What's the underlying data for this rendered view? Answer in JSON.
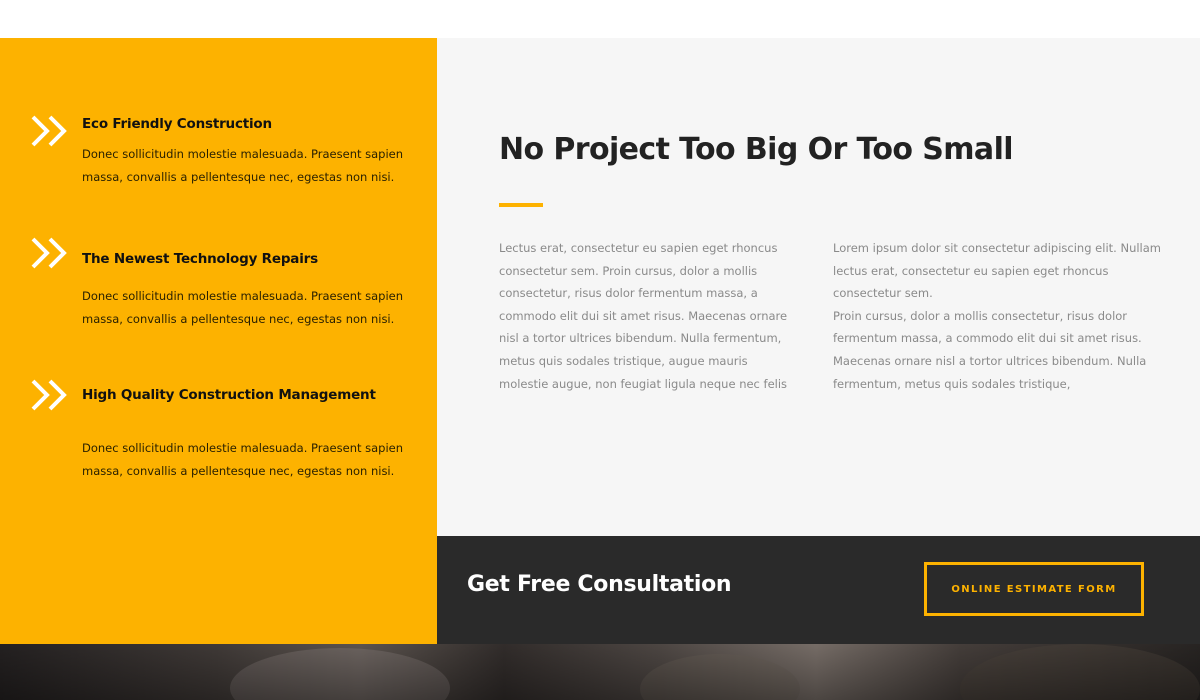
{
  "features": [
    {
      "icon": "double-chevron-right-icon",
      "title": "Eco Friendly Construction",
      "description": "Donec sollicitudin molestie malesuada. Praesent sapien massa, convallis a pellentesque nec, egestas non nisi."
    },
    {
      "icon": "double-chevron-right-icon",
      "title": "The Newest Technology Repairs",
      "description": "Donec sollicitudin molestie malesuada. Praesent sapien massa, convallis a pellentesque nec, egestas non nisi."
    },
    {
      "icon": "double-chevron-right-icon",
      "title": "High Quality Construction Management",
      "description": "Donec sollicitudin molestie malesuada. Praesent sapien massa, convallis a pellentesque nec, egestas non nisi."
    }
  ],
  "about": {
    "heading": "No Project Too Big Or Too Small",
    "column_left": "Lectus erat, consectetur eu sapien eget rhoncus consectetur sem. Proin cursus, dolor a mollis consectetur, risus dolor fermentum massa, a commodo elit dui sit amet risus. Maecenas ornare nisl a tortor ultrices bibendum. Nulla fermentum, metus quis sodales tristique, augue mauris molestie augue, non feugiat ligula neque nec felis",
    "column_right_p1": "Lorem ipsum dolor sit consectetur adipiscing elit. Nullam lectus erat, consectetur eu sapien eget rhoncus consectetur sem.",
    "column_right_p2": "Proin cursus, dolor a mollis consectetur, risus dolor fermentum massa, a commodo elit dui sit amet risus. Maecenas ornare nisl a tortor ultrices bibendum. Nulla fermentum, metus quis sodales tristique,"
  },
  "cta": {
    "title": "Get Free Consultation",
    "button_label": "ONLINE ESTIMATE FORM"
  },
  "colors": {
    "accent": "#fdb200",
    "dark": "#2a2a2a",
    "light_panel": "#f6f6f6"
  }
}
